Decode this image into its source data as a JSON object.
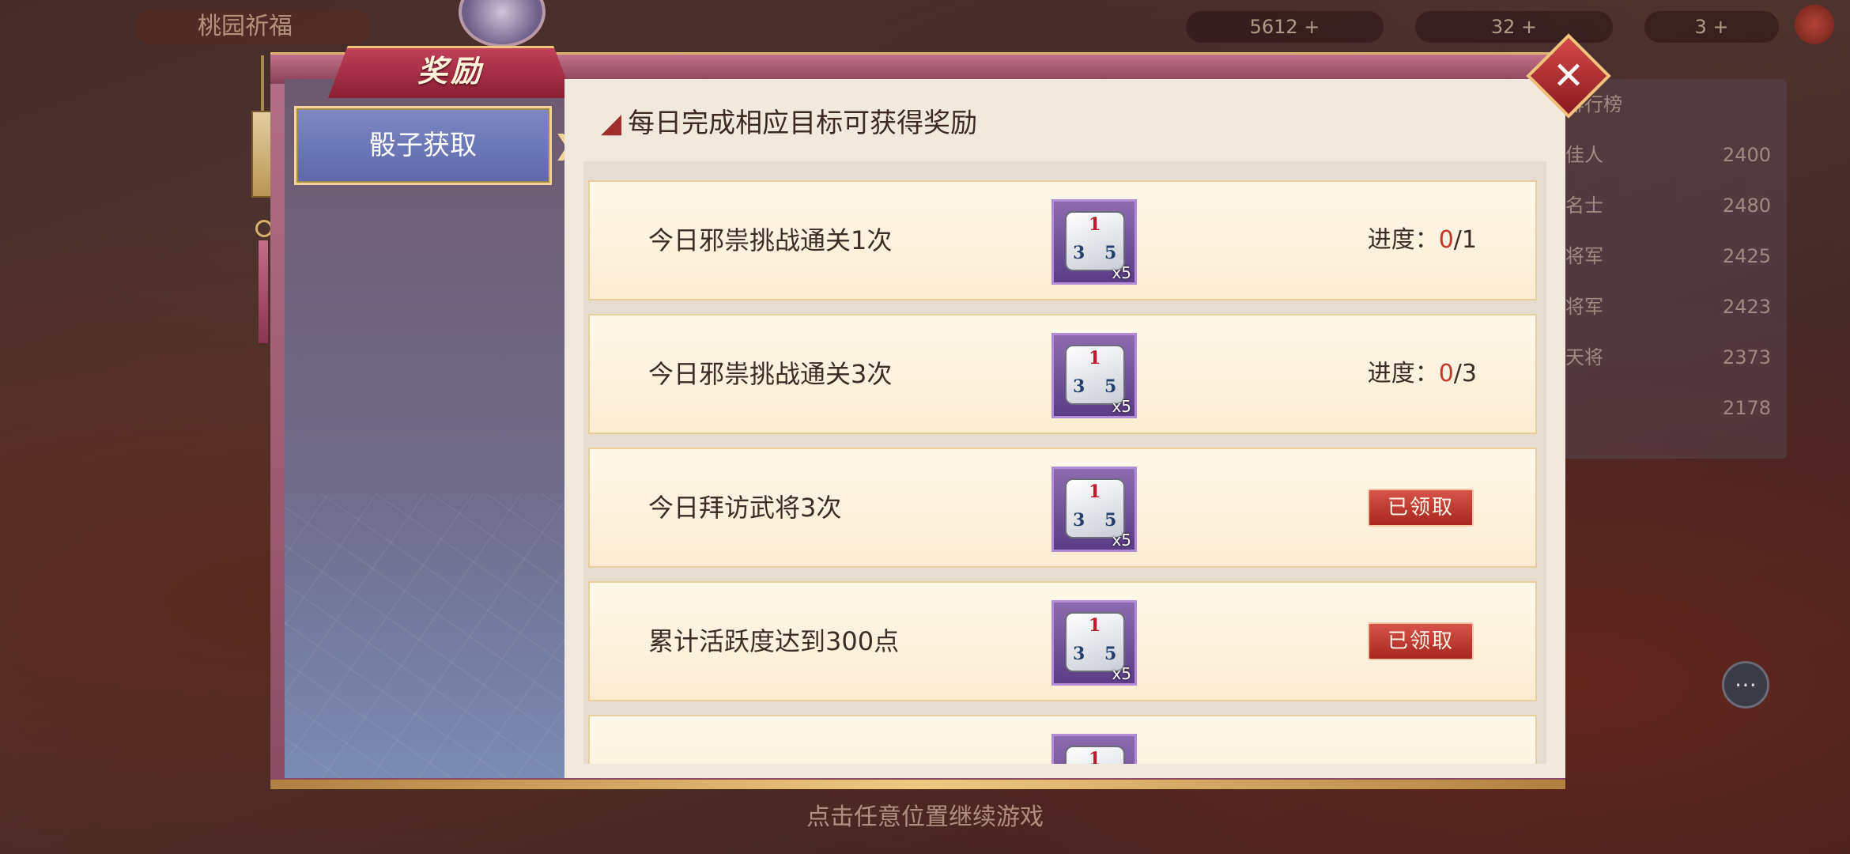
{
  "background": {
    "hud_left_label": "桃园祈福",
    "resources": [
      "5612 +",
      "32 +",
      "3 +"
    ],
    "ranking_rows": [
      {
        "name": "排行榜",
        "value": ""
      },
      {
        "name": "佳人",
        "value": "2400"
      },
      {
        "name": "名士",
        "value": "2480"
      },
      {
        "name": "将军",
        "value": "2425"
      },
      {
        "name": "将军",
        "value": "2423"
      },
      {
        "name": "天将",
        "value": "2373"
      },
      {
        "name": "",
        "value": "2178"
      }
    ],
    "bottom_hint": "点击任意位置继续游戏",
    "chat_icon": "chat-bubble-icon"
  },
  "panel": {
    "title": "奖励",
    "close_icon": "close-icon",
    "tabs": [
      {
        "label": "骰子获取",
        "selected": true
      }
    ],
    "header": "每日完成相应目标可获得奖励",
    "header_icon": "shoe-icon",
    "tasks": [
      {
        "label": "今日邪祟挑战通关1次",
        "reward_icon": "dice-icon",
        "reward_qty": "x5",
        "status": "progress",
        "progress_label": "进度：",
        "progress_current": "0",
        "progress_total": "/1"
      },
      {
        "label": "今日邪祟挑战通关3次",
        "reward_icon": "dice-icon",
        "reward_qty": "x5",
        "status": "progress",
        "progress_label": "进度：",
        "progress_current": "0",
        "progress_total": "/3"
      },
      {
        "label": "今日拜访武将3次",
        "reward_icon": "dice-icon",
        "reward_qty": "x5",
        "status": "claimed",
        "claimed_label": "已领取"
      },
      {
        "label": "累计活跃度达到300点",
        "reward_icon": "dice-icon",
        "reward_qty": "x5",
        "status": "claimed",
        "claimed_label": "已领取"
      },
      {
        "label": "",
        "reward_icon": "dice-icon",
        "reward_qty": "",
        "status": "partial"
      }
    ]
  },
  "colors": {
    "accent_red": "#c0392b",
    "panel_frame": "#b46f86",
    "tab_selected": "#7d88c4",
    "row_bg": "#fff8ea"
  }
}
